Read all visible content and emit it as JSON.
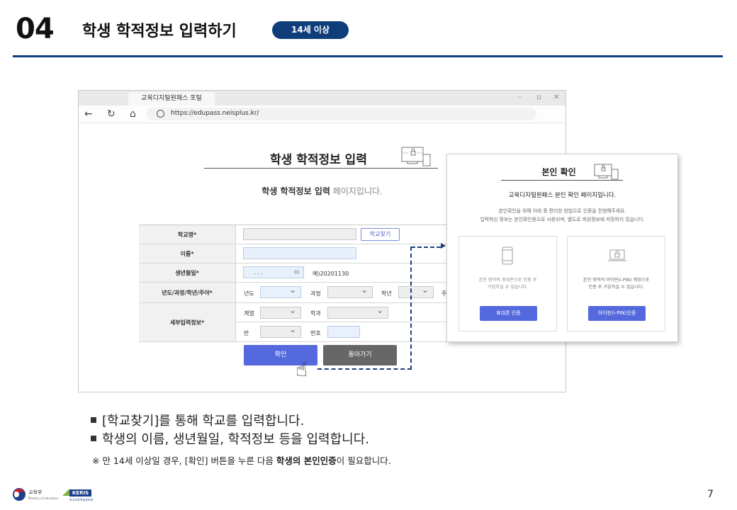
{
  "header": {
    "number": "04",
    "title": "학생 학적정보 입력하기",
    "badge": "14세 이상"
  },
  "browser": {
    "tab_title": "교육디지털원패스 포털",
    "url": "https://edupass.neisplus.kr/",
    "controls": {
      "minimize": "–",
      "maximize": "▫",
      "close": "✕"
    },
    "nav_icons": [
      "back-icon",
      "refresh-icon",
      "home-icon",
      "globe-icon"
    ]
  },
  "page": {
    "title": "학생 학적정보 입력",
    "subtitle_bold": "학생 학적정보 입력",
    "subtitle_rest": " 페이지입니다."
  },
  "form": {
    "school_label": "학교명*",
    "find_school_button": "학교찾기",
    "name_label": "이름*",
    "birth_label": "생년월일*",
    "birth_placeholder": ". . .",
    "birth_example": "예)20201130",
    "grade_label": "년도/과정/학년/주야*",
    "year_label": "년도",
    "course_label": "과정",
    "grade_word": "학년",
    "day_night_label": "주",
    "detail_label": "세부입력정보*",
    "track_label": "계열",
    "dept_label": "학과",
    "class_label": "반",
    "number_label": "번호",
    "confirm_button": "확인",
    "back_button": "돌아가기"
  },
  "popup": {
    "title": "본인 확인",
    "subtitle": "교육디지털원패스 본인 확인 페이지입니다.",
    "desc_line1": "본인확인을 위해 아래 중 편리한 방법으로 인증을 진행해주세요.",
    "desc_line2": "입력하신 정보는 본인확인용으로 사용되며, 별도로 회원정보에 저장하지 않습니다.",
    "phone_box_text_1": "본인 명의의 휴대폰으로 인증 후",
    "phone_box_text_2": "가입하실 수 있습니다.",
    "phone_button": "휴대폰 인증",
    "ipin_box_text_1": "본인 명의의 아이핀(i-PIN) 계정으로",
    "ipin_box_text_2": "인증 후 가입하실 수 있습니다.",
    "ipin_button": "아이핀(i-PIN)인증"
  },
  "bullets": [
    "[학교찾기]를 통해 학교를 입력합니다.",
    "학생의 이름, 생년월일, 학적정보 등을 입력합니다."
  ],
  "note": {
    "prefix": "※ 만 14세 이상일 경우, [확인] 버튼을 누른 다음 ",
    "bold": "학생의 본인인증",
    "suffix": "이 필요합니다."
  },
  "footer": {
    "ministry_name": "교육부",
    "ministry_sub": "Ministry of education",
    "keris_logo": "KERIS",
    "keris_sub": "한국교육학술정보원",
    "page_number": "7"
  },
  "colors": {
    "brand_navy": "#0f3d7a",
    "accent_blue": "#5469dd",
    "back_gray": "#666666"
  }
}
